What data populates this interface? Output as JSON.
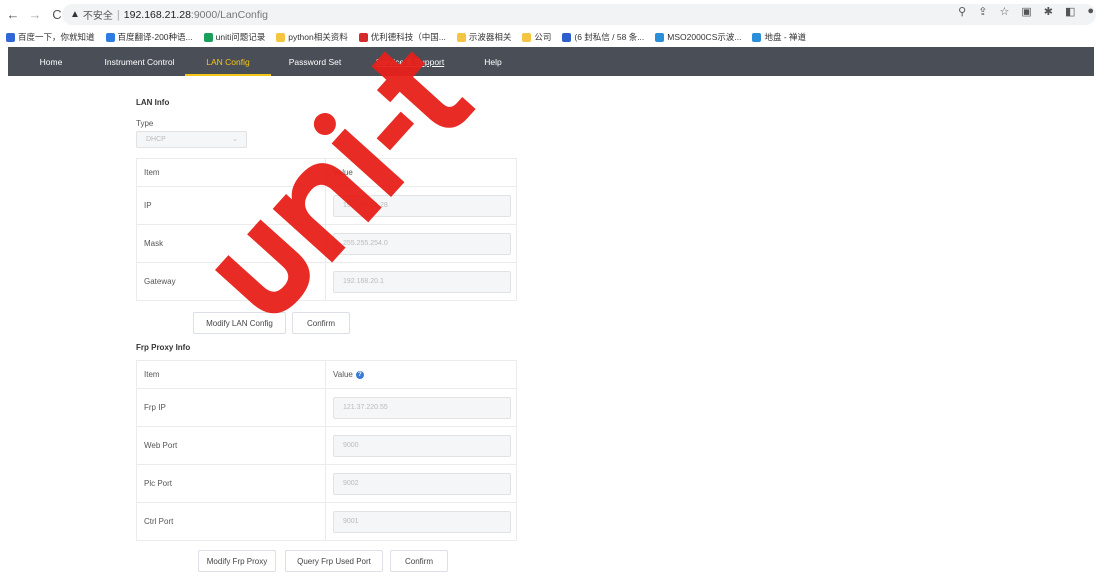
{
  "browser": {
    "back": "←",
    "forward": "→",
    "reload": "C",
    "insecure_label": "不安全",
    "url_host": "192.168.21.28",
    "url_path": ":9000/LanConfig",
    "bookmarks": [
      {
        "label": "百度一下，你就知道",
        "color": "#3066d6"
      },
      {
        "label": "百度翻译-200种语...",
        "color": "#2d7be5"
      },
      {
        "label": "uniti问题记录",
        "color": "#1a9e5c"
      },
      {
        "label": "python相关资料",
        "color": "#f4c542"
      },
      {
        "label": "优利德科技（中国...",
        "color": "#d62a2a"
      },
      {
        "label": "示波器相关",
        "color": "#f4c542"
      },
      {
        "label": "公司",
        "color": "#f4c542"
      },
      {
        "label": "(6 封私信 / 58 条...",
        "color": "#2d5fcf"
      },
      {
        "label": "MSO2000CS示波...",
        "color": "#2a8fd8"
      },
      {
        "label": "地盘 - 禅道",
        "color": "#2a8fd8"
      }
    ]
  },
  "nav": {
    "items": [
      {
        "label": "Home"
      },
      {
        "label": "Instrument Control"
      },
      {
        "label": "LAN Config"
      },
      {
        "label": "Password Set"
      },
      {
        "label": "Service & Support"
      },
      {
        "label": "Help"
      }
    ],
    "active_color": "#f5c518",
    "bar_color": "#4a4f57"
  },
  "lan": {
    "title": "LAN Info",
    "type_label": "Type",
    "type_value": "DHCP",
    "header_item": "Item",
    "header_value": "Value",
    "rows": [
      {
        "item": "IP",
        "value": "192.168.21.28"
      },
      {
        "item": "Mask",
        "value": "255.255.254.0"
      },
      {
        "item": "Gateway",
        "value": "192.168.20.1"
      }
    ],
    "modify_btn": "Modify LAN Config",
    "confirm_btn": "Confirm"
  },
  "frp": {
    "title": "Frp Proxy Info",
    "header_item": "Item",
    "header_value": "Value",
    "rows": [
      {
        "item": "Frp IP",
        "value": "121.37.220.55"
      },
      {
        "item": "Web Port",
        "value": "9000"
      },
      {
        "item": "Plc Port",
        "value": "9002"
      },
      {
        "item": "Ctrl Port",
        "value": "9001"
      }
    ],
    "modify_btn": "Modify Frp Proxy",
    "query_btn": "Query Frp Used Port",
    "confirm_btn": "Confirm"
  },
  "watermark": {
    "text": "uni-t",
    "color": "#e8201a"
  }
}
